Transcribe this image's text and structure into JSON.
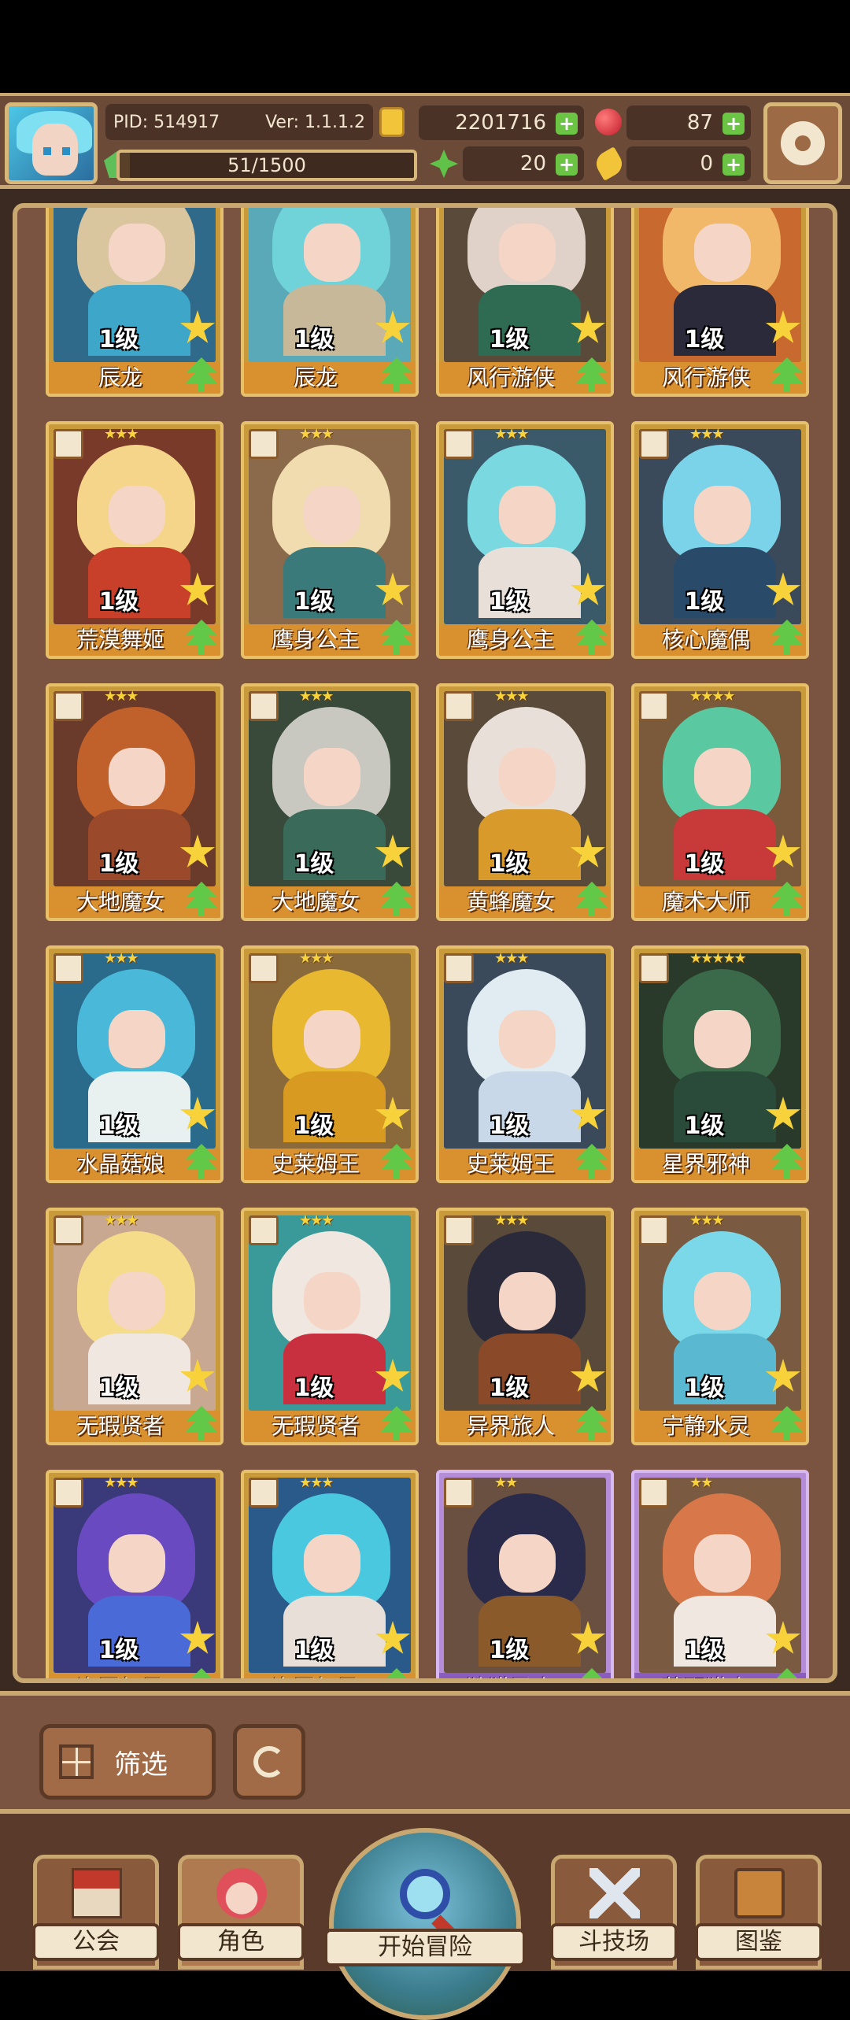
{
  "header": {
    "pid": "PID: 514917",
    "version": "Ver: 1.1.1.2",
    "coins": "2201716",
    "gems": "87",
    "energy": "51/1500",
    "energy_fraction": 0.034,
    "clovers": "20",
    "horns": "0"
  },
  "cards": [
    {
      "level": "1级",
      "name": "辰龙",
      "frame": "gold",
      "hair": "#d9c69e",
      "body": "#3ea7c9",
      "bg": "#2f6a8a"
    },
    {
      "level": "1级",
      "name": "辰龙",
      "frame": "gold",
      "hair": "#6fd3d9",
      "body": "#c8b89a",
      "bg": "#5aa9b8"
    },
    {
      "level": "1级",
      "name": "风行游侠",
      "frame": "gold",
      "hair": "#e0d2c8",
      "body": "#2f6b52",
      "bg": "#5a4a3a"
    },
    {
      "level": "1级",
      "name": "风行游侠",
      "frame": "gold",
      "hair": "#f2b86a",
      "body": "#2a2a3a",
      "bg": "#c86a30"
    },
    {
      "level": "1级",
      "name": "荒漠舞姬",
      "frame": "gold",
      "stars": "★★★",
      "hair": "#f5d58a",
      "body": "#c8402a",
      "bg": "#7a3a2a"
    },
    {
      "level": "1级",
      "name": "鹰身公主",
      "frame": "gold",
      "stars": "★★★",
      "hair": "#f0dcae",
      "body": "#3a7a7a",
      "bg": "#8a6a4a"
    },
    {
      "level": "1级",
      "name": "鹰身公主",
      "frame": "gold",
      "stars": "★★★",
      "hair": "#7ad9e0",
      "body": "#e8e0d8",
      "bg": "#3a5a6a"
    },
    {
      "level": "1级",
      "name": "核心魔偶",
      "frame": "gold",
      "stars": "★★★",
      "hair": "#7ad3e8",
      "body": "#2a4a6a",
      "bg": "#3a4a5a"
    },
    {
      "level": "1级",
      "name": "大地魔女",
      "frame": "gold",
      "stars": "★★★",
      "hair": "#c0602a",
      "body": "#9a4a2a",
      "bg": "#6a3a2a"
    },
    {
      "level": "1级",
      "name": "大地魔女",
      "frame": "gold",
      "stars": "★★★",
      "hair": "#c8c8c0",
      "body": "#3a6a5a",
      "bg": "#3a4a3a"
    },
    {
      "level": "1级",
      "name": "黄蜂魔女",
      "frame": "gold",
      "stars": "★★★",
      "hair": "#e8e0d8",
      "body": "#d89a2a",
      "bg": "#5a4a3a"
    },
    {
      "level": "1级",
      "name": "魔术大师",
      "frame": "gold",
      "stars": "★★★★",
      "hair": "#5ac8a0",
      "body": "#c83a3a",
      "bg": "#7a5a3a"
    },
    {
      "level": "1级",
      "name": "水晶菇娘",
      "frame": "gold",
      "stars": "★★★",
      "hair": "#4ab8d8",
      "body": "#e8f0f0",
      "bg": "#2a6a8a"
    },
    {
      "level": "1级",
      "name": "史莱姆王",
      "frame": "gold",
      "stars": "★★★",
      "hair": "#e8b830",
      "body": "#d89a20",
      "bg": "#8a6a3a"
    },
    {
      "level": "1级",
      "name": "史莱姆王",
      "frame": "gold",
      "stars": "★★★",
      "hair": "#e0ecf2",
      "body": "#c8d8e8",
      "bg": "#3a4a5a"
    },
    {
      "level": "1级",
      "name": "星界邪神",
      "frame": "gold",
      "stars": "★★★★★",
      "hair": "#3a6a4a",
      "body": "#2a4a3a",
      "bg": "#2a3a2a"
    },
    {
      "level": "1级",
      "name": "无瑕贤者",
      "frame": "gold",
      "stars": "★★★",
      "hair": "#f5dc8a",
      "body": "#f0e8e0",
      "bg": "#c8a890"
    },
    {
      "level": "1级",
      "name": "无瑕贤者",
      "frame": "gold",
      "stars": "★★★",
      "hair": "#f0e8e0",
      "body": "#c83040",
      "bg": "#3a9a9a"
    },
    {
      "level": "1级",
      "name": "异界旅人",
      "frame": "gold",
      "stars": "★★★",
      "hair": "#2a2a3a",
      "body": "#8a4a2a",
      "bg": "#5a4a3a"
    },
    {
      "level": "1级",
      "name": "宁静水灵",
      "frame": "gold",
      "stars": "★★★",
      "hair": "#7ad8e8",
      "body": "#5ab8d0",
      "bg": "#7a5a40"
    },
    {
      "level": "1级",
      "name": "许愿灯灵",
      "frame": "gold",
      "stars": "★★★",
      "hair": "#6a4ac0",
      "body": "#4a6ad8",
      "bg": "#3a3a7a"
    },
    {
      "level": "1级",
      "name": "许愿灯灵",
      "frame": "gold",
      "stars": "★★★",
      "hair": "#4ac8e0",
      "body": "#e8e0d8",
      "bg": "#2a5a8a"
    },
    {
      "level": "1级",
      "name": "狩猎勇士",
      "frame": "purple",
      "stars": "★★",
      "hair": "#2a2a4a",
      "body": "#8a5a2a",
      "bg": "#6a5040"
    },
    {
      "level": "1级",
      "name": "荒野猎人",
      "frame": "purple",
      "stars": "★★",
      "hair": "#d8784a",
      "body": "#f0e8e0",
      "bg": "#7a5a40"
    }
  ],
  "filter": {
    "label": "筛选"
  },
  "nav": {
    "guild": "公会",
    "character": "角色",
    "adventure": "开始冒险",
    "arena": "斗技场",
    "codex": "图鉴"
  }
}
